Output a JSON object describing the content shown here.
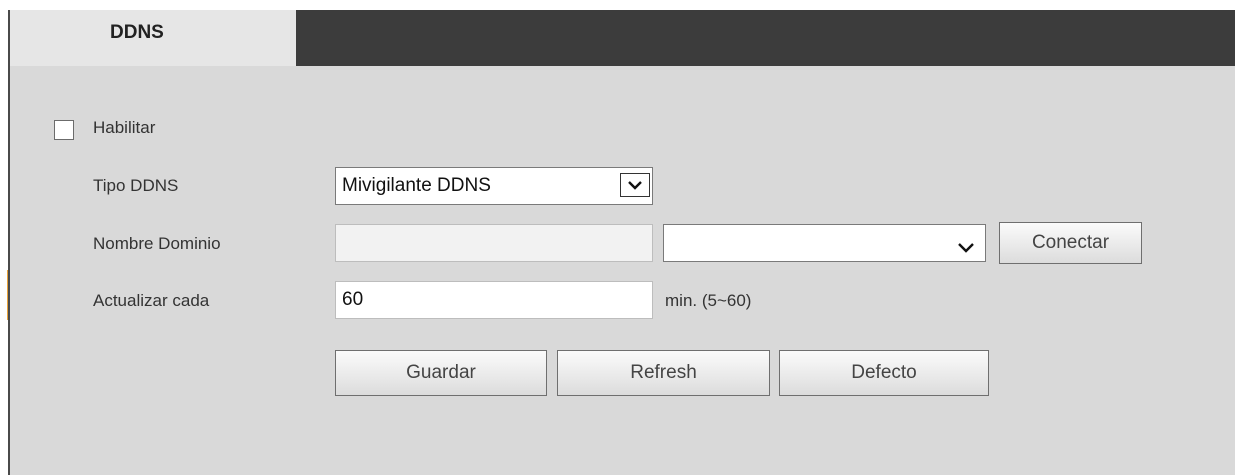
{
  "tab": {
    "label": "DDNS"
  },
  "form": {
    "enable_label": "Habilitar",
    "enable_checked": false,
    "ddns_type_label": "Tipo DDNS",
    "ddns_type_value": "Mivigilante DDNS",
    "domain_label": "Nombre Dominio",
    "domain_value": "",
    "domain_suffix_value": "",
    "connect_label": "Conectar",
    "update_label": "Actualizar cada",
    "update_value": "60",
    "update_hint": "min. (5~60)"
  },
  "buttons": {
    "save": "Guardar",
    "refresh": "Refresh",
    "default": "Defecto"
  },
  "icons": {
    "select_arrow": "chevron-down-icon"
  }
}
